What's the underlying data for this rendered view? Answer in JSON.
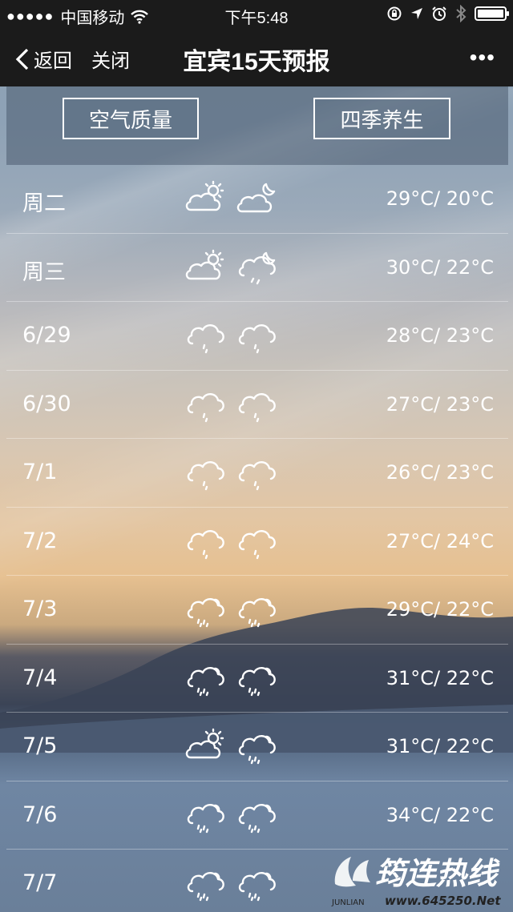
{
  "status_bar": {
    "carrier": "中国移动",
    "time": "下午5:48"
  },
  "nav": {
    "back_label": "返回",
    "close_label": "关闭",
    "title": "宜宾15天预报",
    "more_label": "•••"
  },
  "buttons": {
    "air_quality": "空气质量",
    "season_health": "四季养生"
  },
  "forecast": [
    {
      "day": "周二",
      "day_icon": "partly-cloudy-day-icon",
      "night_icon": "partly-cloudy-night-icon",
      "temp": "29°C/ 20°C"
    },
    {
      "day": "周三",
      "day_icon": "partly-cloudy-day-icon",
      "night_icon": "night-shower-icon",
      "temp": "30°C/ 22°C"
    },
    {
      "day": "6/29",
      "day_icon": "rain-icon",
      "night_icon": "rain-icon",
      "temp": "28°C/ 23°C"
    },
    {
      "day": "6/30",
      "day_icon": "rain-icon",
      "night_icon": "rain-icon",
      "temp": "27°C/ 23°C"
    },
    {
      "day": "7/1",
      "day_icon": "rain-icon",
      "night_icon": "rain-icon",
      "temp": "26°C/ 23°C"
    },
    {
      "day": "7/2",
      "day_icon": "rain-icon",
      "night_icon": "rain-icon",
      "temp": "27°C/ 24°C"
    },
    {
      "day": "7/3",
      "day_icon": "thundershower-icon",
      "night_icon": "thundershower-icon",
      "temp": "29°C/ 22°C"
    },
    {
      "day": "7/4",
      "day_icon": "thundershower-icon",
      "night_icon": "thundershower-icon",
      "temp": "31°C/ 22°C"
    },
    {
      "day": "7/5",
      "day_icon": "partly-cloudy-day-icon",
      "night_icon": "thundershower-icon",
      "temp": "31°C/ 22°C"
    },
    {
      "day": "7/6",
      "day_icon": "thundershower-icon",
      "night_icon": "thundershower-icon",
      "temp": "34°C/ 22°C"
    },
    {
      "day": "7/7",
      "day_icon": "thundershower-icon",
      "night_icon": "thundershower-icon",
      "temp": ""
    }
  ],
  "watermark": {
    "brand": "筠连热线",
    "latin": "JUNLIAN",
    "url": "www.645250.Net"
  }
}
